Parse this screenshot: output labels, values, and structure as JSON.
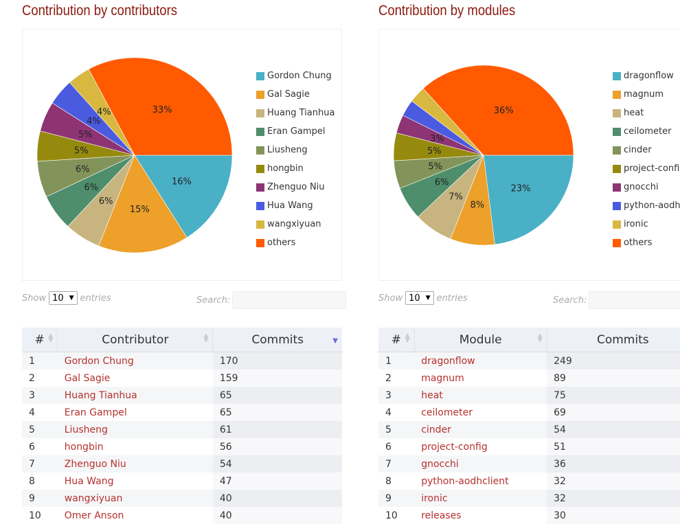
{
  "contributors": {
    "title": "Contribution by contributors",
    "show_label": "Show",
    "entries_label": "entries",
    "page_size": "10",
    "search_label": "Search:",
    "columns": [
      "#",
      "Contributor",
      "Commits"
    ],
    "rows": [
      [
        "1",
        "Gordon Chung",
        "170"
      ],
      [
        "2",
        "Gal Sagie",
        "159"
      ],
      [
        "3",
        "Huang Tianhua",
        "65"
      ],
      [
        "4",
        "Eran Gampel",
        "65"
      ],
      [
        "5",
        "Liusheng",
        "61"
      ],
      [
        "6",
        "hongbin",
        "56"
      ],
      [
        "7",
        "Zhenguo Niu",
        "54"
      ],
      [
        "8",
        "Hua Wang",
        "47"
      ],
      [
        "9",
        "wangxiyuan",
        "40"
      ],
      [
        "10",
        "Omer Anson",
        "40"
      ]
    ]
  },
  "modules": {
    "title": "Contribution by modules",
    "show_label": "Show",
    "entries_label": "entries",
    "page_size": "10",
    "search_label": "Search:",
    "columns": [
      "#",
      "Module",
      "Commits"
    ],
    "rows": [
      [
        "1",
        "dragonflow",
        "249"
      ],
      [
        "2",
        "magnum",
        "89"
      ],
      [
        "3",
        "heat",
        "75"
      ],
      [
        "4",
        "ceilometer",
        "69"
      ],
      [
        "5",
        "cinder",
        "54"
      ],
      [
        "6",
        "project-config",
        "51"
      ],
      [
        "7",
        "gnocchi",
        "36"
      ],
      [
        "8",
        "python-aodhclient",
        "32"
      ],
      [
        "9",
        "ironic",
        "32"
      ],
      [
        "10",
        "releases",
        "30"
      ]
    ]
  },
  "chart_data": [
    {
      "type": "pie",
      "title": "Contribution by contributors",
      "legend": "right",
      "labels": [
        "Gordon Chung",
        "Gal Sagie",
        "Huang Tianhua",
        "Eran Gampel",
        "Liusheng",
        "hongbin",
        "Zhenguo Niu",
        "Hua Wang",
        "wangxiyuan",
        "others"
      ],
      "values": [
        16,
        15,
        6,
        6,
        6,
        5,
        5,
        4.4,
        3.8,
        32.8
      ],
      "data_labels": [
        "16%",
        "15%",
        "6%",
        "6%",
        "6%",
        "5%",
        "5%",
        "4%",
        "4%",
        "33%"
      ],
      "colors": [
        "#4ab0c6",
        "#eda02a",
        "#c8b47f",
        "#4e8e6c",
        "#83945a",
        "#968a0e",
        "#8e3474",
        "#4a5be0",
        "#d8b840",
        "#ff5a00"
      ]
    },
    {
      "type": "pie",
      "title": "Contribution by modules",
      "legend": "right",
      "labels": [
        "dragonflow",
        "magnum",
        "heat",
        "ceilometer",
        "cinder",
        "project-config",
        "gnocchi",
        "python-aodhclient",
        "ironic",
        "others"
      ],
      "values": [
        23,
        8,
        7,
        6,
        5,
        5,
        3.3,
        3,
        3,
        36.7
      ],
      "data_labels": [
        "23%",
        "8%",
        "7%",
        "6%",
        "5%",
        "5%",
        "3%",
        "",
        "",
        "36%"
      ],
      "colors": [
        "#4ab0c6",
        "#eda02a",
        "#c8b47f",
        "#4e8e6c",
        "#83945a",
        "#968a0e",
        "#8e3474",
        "#4a5be0",
        "#d8b840",
        "#ff5a00"
      ]
    }
  ]
}
